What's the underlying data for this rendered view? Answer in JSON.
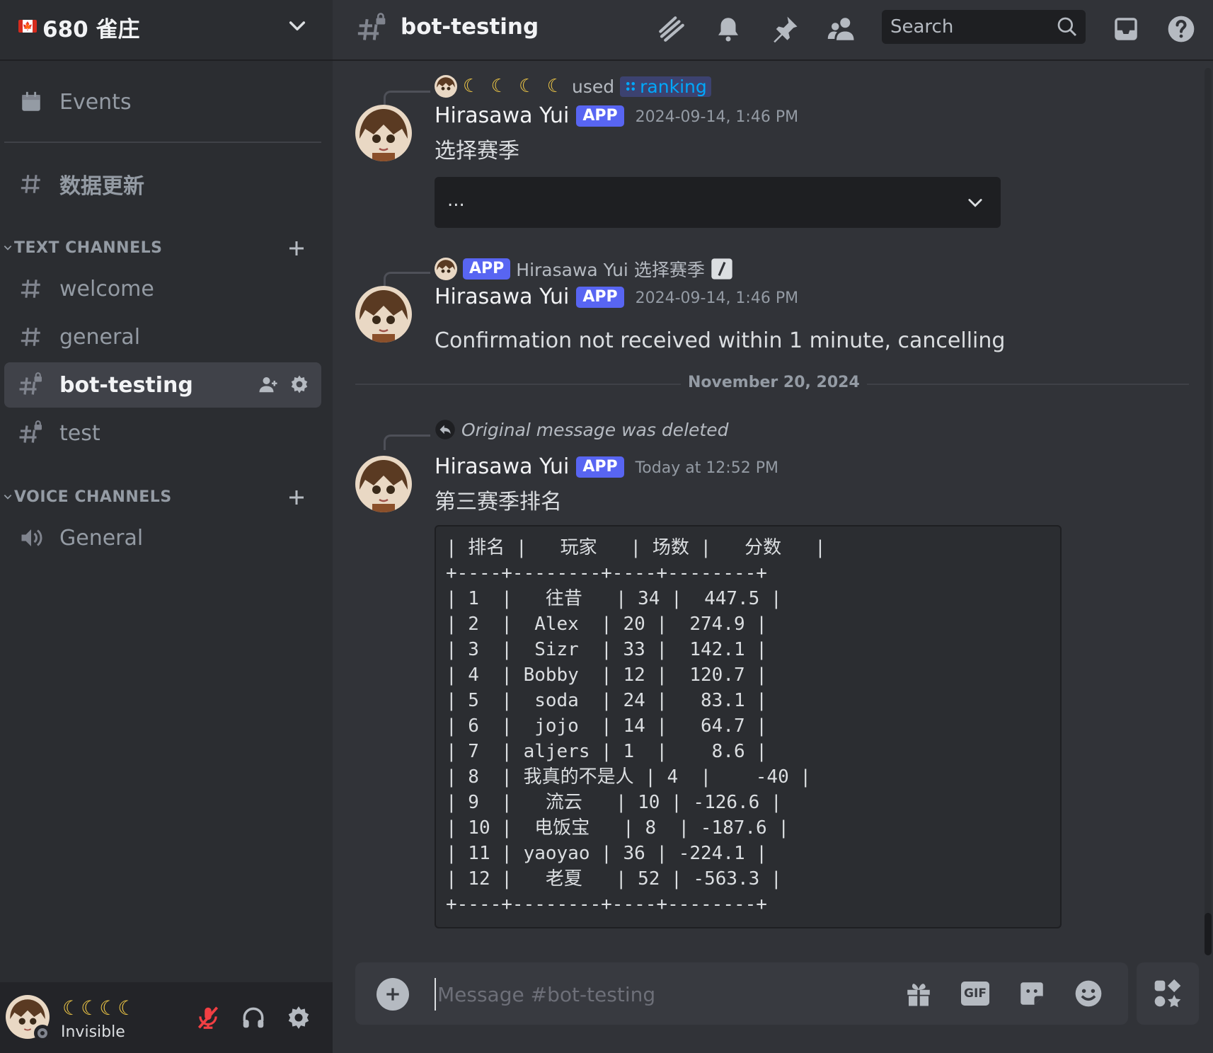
{
  "server": {
    "flag": "🍁",
    "name": "680 雀庄"
  },
  "sidebar": {
    "events_label": "Events",
    "data_channel": "数据更新",
    "text_category": "TEXT CHANNELS",
    "voice_category": "VOICE CHANNELS",
    "text_channels": [
      {
        "label": "welcome"
      },
      {
        "label": "general"
      },
      {
        "label": "bot-testing"
      },
      {
        "label": "test"
      }
    ],
    "voice_channels": [
      {
        "label": "General"
      }
    ]
  },
  "user": {
    "name": "☾☾☾☾",
    "status": "Invisible"
  },
  "topbar": {
    "channel": "bot-testing",
    "search_placeholder": "Search"
  },
  "messages": [
    {
      "reply_moons": "☾ ☾ ☾ ☾",
      "reply_used": "used",
      "reply_command": "ranking",
      "author": "Hirasawa Yui",
      "badge": "APP",
      "timestamp": "2024-09-14, 1:46 PM",
      "text": "选择赛季",
      "select_value": "..."
    },
    {
      "reply_badge": "APP",
      "reply_text": "Hirasawa Yui 选择赛季",
      "author": "Hirasawa Yui",
      "badge": "APP",
      "timestamp": "2024-09-14, 1:46 PM",
      "text": "Confirmation not received within 1 minute, cancelling"
    },
    {
      "reply_text": "Original message was deleted",
      "author": "Hirasawa Yui",
      "badge": "APP",
      "timestamp": "Today at 12:52 PM",
      "text": "第三赛季排名",
      "code": "| 排名 |   玩家   | 场数 |   分数   |\n+----+--------+----+--------+\n| 1  |   往昔   | 34 |  447.5 |\n| 2  |  Alex  | 20 |  274.9 |\n| 3  |  Sizr  | 33 |  142.1 |\n| 4  | Bobby  | 12 |  120.7 |\n| 5  |  soda  | 24 |   83.1 |\n| 6  |  jojo  | 14 |   64.7 |\n| 7  | aljers | 1  |    8.6 |\n| 8  | 我真的不是人 | 4  |    -40 |\n| 9  |   流云   | 10 | -126.6 |\n| 10 |  电饭宝   | 8  | -187.6 |\n| 11 | yaoyao | 36 | -224.1 |\n| 12 |   老夏   | 52 | -563.3 |\n+----+--------+----+--------+"
    }
  ],
  "date_divider": "November 20, 2024",
  "composer": {
    "placeholder": "Message #bot-testing",
    "gif_label": "GIF"
  }
}
